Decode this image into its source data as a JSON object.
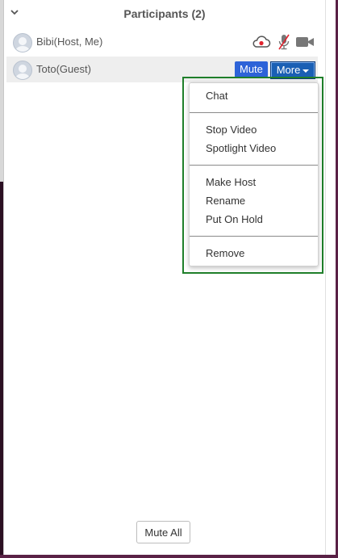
{
  "header": {
    "title": "Participants (2)",
    "collapse_icon": "chevron-down"
  },
  "participants": [
    {
      "name": "Bibi(Host, Me)",
      "icons": [
        "cloud-recording-icon",
        "mic-muted-icon",
        "camera-icon"
      ]
    },
    {
      "name": "Toto(Guest)",
      "actions": {
        "mute_label": "Mute",
        "more_label": "More"
      }
    }
  ],
  "more_menu": {
    "groups": [
      [
        "Chat"
      ],
      [
        "Stop Video",
        "Spotlight Video"
      ],
      [
        "Make Host",
        "Rename",
        "Put On Hold"
      ],
      [
        "Remove"
      ]
    ]
  },
  "footer": {
    "mute_all_label": "Mute All"
  },
  "colors": {
    "mute_button": "#2d63d8",
    "more_button": "#1a5fb4",
    "highlight_border": "#1f7f2a",
    "recording_red": "#e0242f"
  }
}
